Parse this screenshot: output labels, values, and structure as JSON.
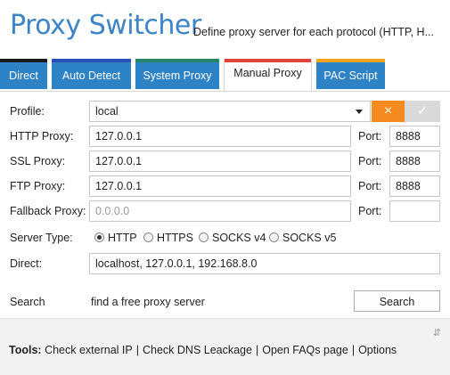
{
  "header": {
    "title": "Proxy Switcher",
    "subtitle": "Define proxy server for each protocol (HTTP, H..."
  },
  "tabs": [
    {
      "label": "Direct",
      "color": "#1a1a1a"
    },
    {
      "label": "Auto Detect",
      "color": "#2a4fb7"
    },
    {
      "label": "System Proxy",
      "color": "#25856a"
    },
    {
      "label": "Manual Proxy",
      "color": "#e0443a",
      "active": true
    },
    {
      "label": "PAC Script",
      "color": "#f3a21e"
    }
  ],
  "form": {
    "profile_label": "Profile:",
    "profile_value": "local",
    "delete_icon": "×",
    "ok_icon": "✓",
    "http_label": "HTTP Proxy:",
    "http_value": "127.0.0.1",
    "ssl_label": "SSL Proxy:",
    "ssl_value": "127.0.0.1",
    "ftp_label": "FTP Proxy:",
    "ftp_value": "127.0.0.1",
    "fallback_label": "Fallback Proxy:",
    "fallback_placeholder": "0.0.0.0",
    "port_label": "Port:",
    "http_port": "8888",
    "ssl_port": "8888",
    "ftp_port": "8888",
    "fallback_port": "",
    "server_type_label": "Server Type:",
    "server_types": [
      "HTTP",
      "HTTPS",
      "SOCKS v4",
      "SOCKS v5"
    ],
    "server_type_selected": "HTTP",
    "direct_label": "Direct:",
    "direct_value": "localhost, 127.0.0.1, 192.168.8.0",
    "search_label": "Search",
    "search_text": "find a free proxy server",
    "search_button": "Search"
  },
  "footer": {
    "tools_label": "Tools:",
    "links": [
      "Check external IP",
      "Check DNS Leackage",
      "Open FAQs page",
      "Options"
    ],
    "resize_icon": "⇵"
  },
  "colors": {
    "title": "#3d84c6",
    "tab_bg": "#2e82c6",
    "delete_button": "#f58a1f",
    "ok_button": "#d9d9d9"
  }
}
